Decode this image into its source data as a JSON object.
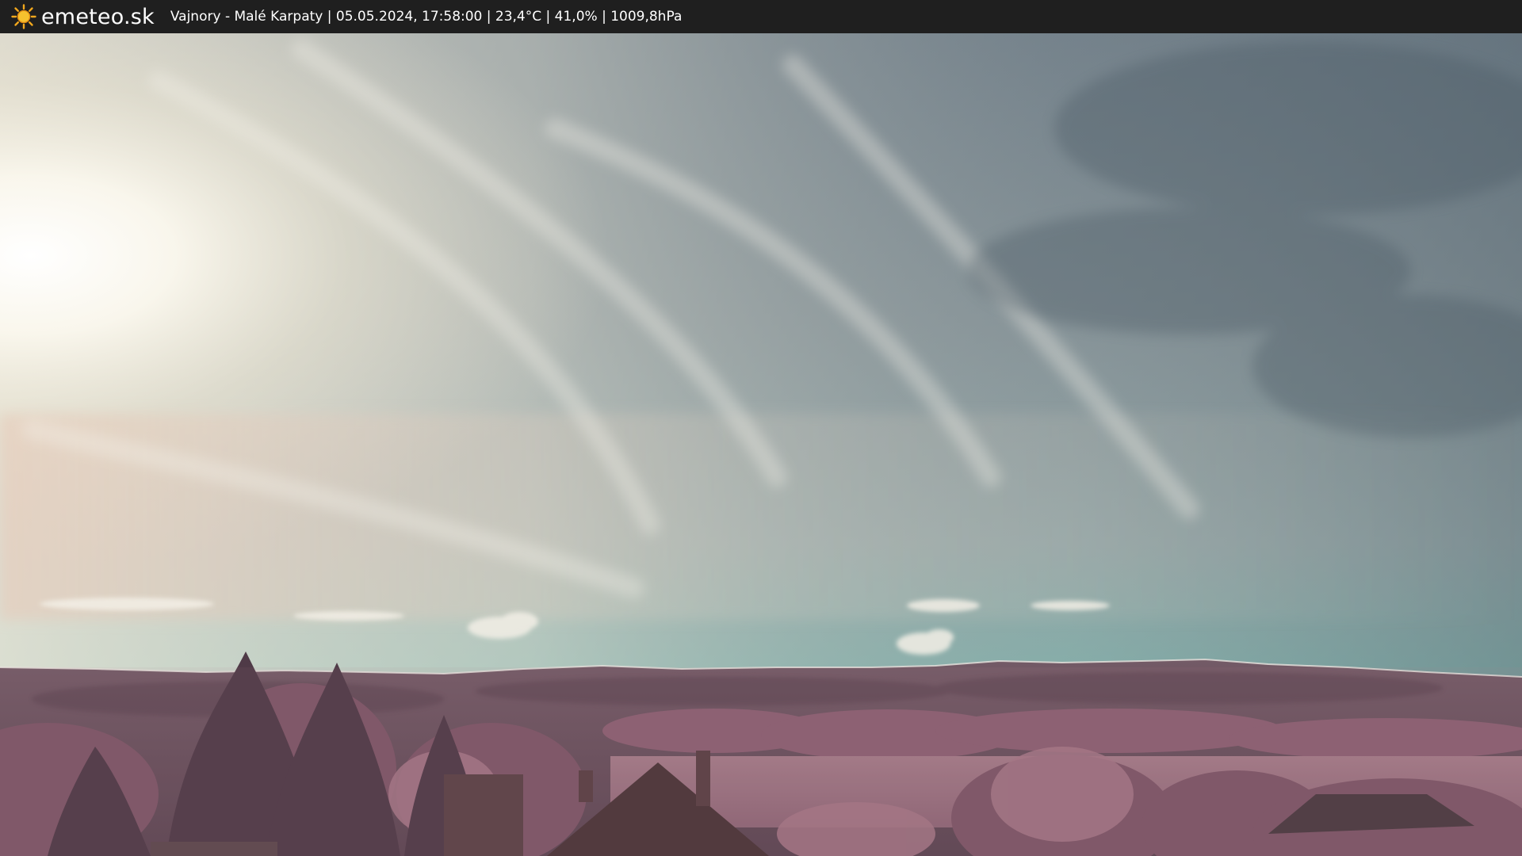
{
  "header": {
    "logo_text": "emeteo.sk",
    "logo_icon": "sun-icon",
    "caption": "Vajnory - Malé Karpaty | 05.05.2024, 17:58:00 | 23,4°C | 41,0% | 1009,8hPa"
  },
  "colors": {
    "bar_background": "#1f1f1f",
    "sun_accent": "#f2a81d",
    "sky_bright": "#f6f2e6",
    "sky_haze": "#c9ccc4",
    "sky_upper": "#5d6d78",
    "sky_horizon": "#8fc1b8",
    "hills": "#6e5561",
    "foliage": "#8e6475",
    "field": "#9a7080",
    "roof": "#4a3538"
  }
}
